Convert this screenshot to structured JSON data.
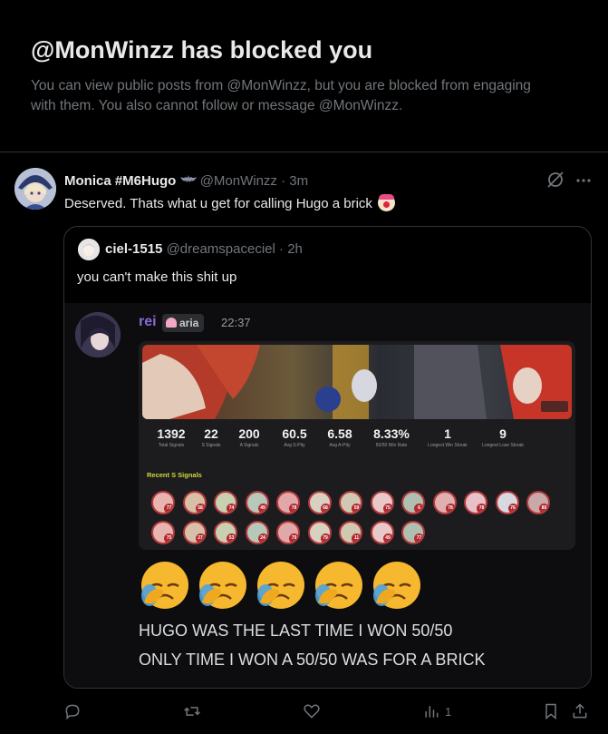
{
  "blocked": {
    "title": "@MonWinzz has blocked you",
    "description": "You can view public posts from @MonWinzz, but you are blocked from engaging with them. You also cannot follow or message @MonWinzz."
  },
  "tweet": {
    "name": "Monica #M6Hugo",
    "handle": "@MonWinzz",
    "separator": " · ",
    "time": "3m",
    "text": "Deserved. Thats what u get for calling Hugo a brick "
  },
  "quote": {
    "name": "ciel-1515",
    "handle": "@dreamspaceciel",
    "separator": " · ",
    "time": "2h",
    "text": "you can't make this shit up"
  },
  "discord": {
    "username": "rei",
    "tag": "aria",
    "time": "22:37",
    "stats": [
      {
        "value": "1392",
        "label": "Total Signals"
      },
      {
        "value": "22",
        "label": "S Signals"
      },
      {
        "value": "200",
        "label": "A Signals"
      },
      {
        "value": "60.5",
        "label": "Avg S-Pity"
      },
      {
        "value": "6.58",
        "label": "Avg A-Pity"
      },
      {
        "value": "8.33%",
        "label": "50/50 Win Rate"
      },
      {
        "value": "1",
        "label": "Longest Win Streak"
      },
      {
        "value": "9",
        "label": "Longest Lose Streak"
      }
    ],
    "recent_label": "Recent S Signals",
    "recent_pities": [
      "77",
      "58",
      "74",
      "49",
      "78",
      "68",
      "59",
      "75",
      "6",
      "78",
      "78",
      "76",
      "80",
      "75",
      "27",
      "53",
      "24",
      "79",
      "79",
      "11",
      "49",
      "77"
    ],
    "line1": "HUGO WAS THE LAST TIME I WON 50/50",
    "line2": "ONLY TIME I WON A 50/50 WAS FOR A BRICK"
  },
  "actions": {
    "views": "1"
  },
  "colors": {
    "background": "#000000",
    "text": "#e7e9ea",
    "muted": "#71767b",
    "border": "#2f3336",
    "discord_name": "#8b66d8"
  }
}
